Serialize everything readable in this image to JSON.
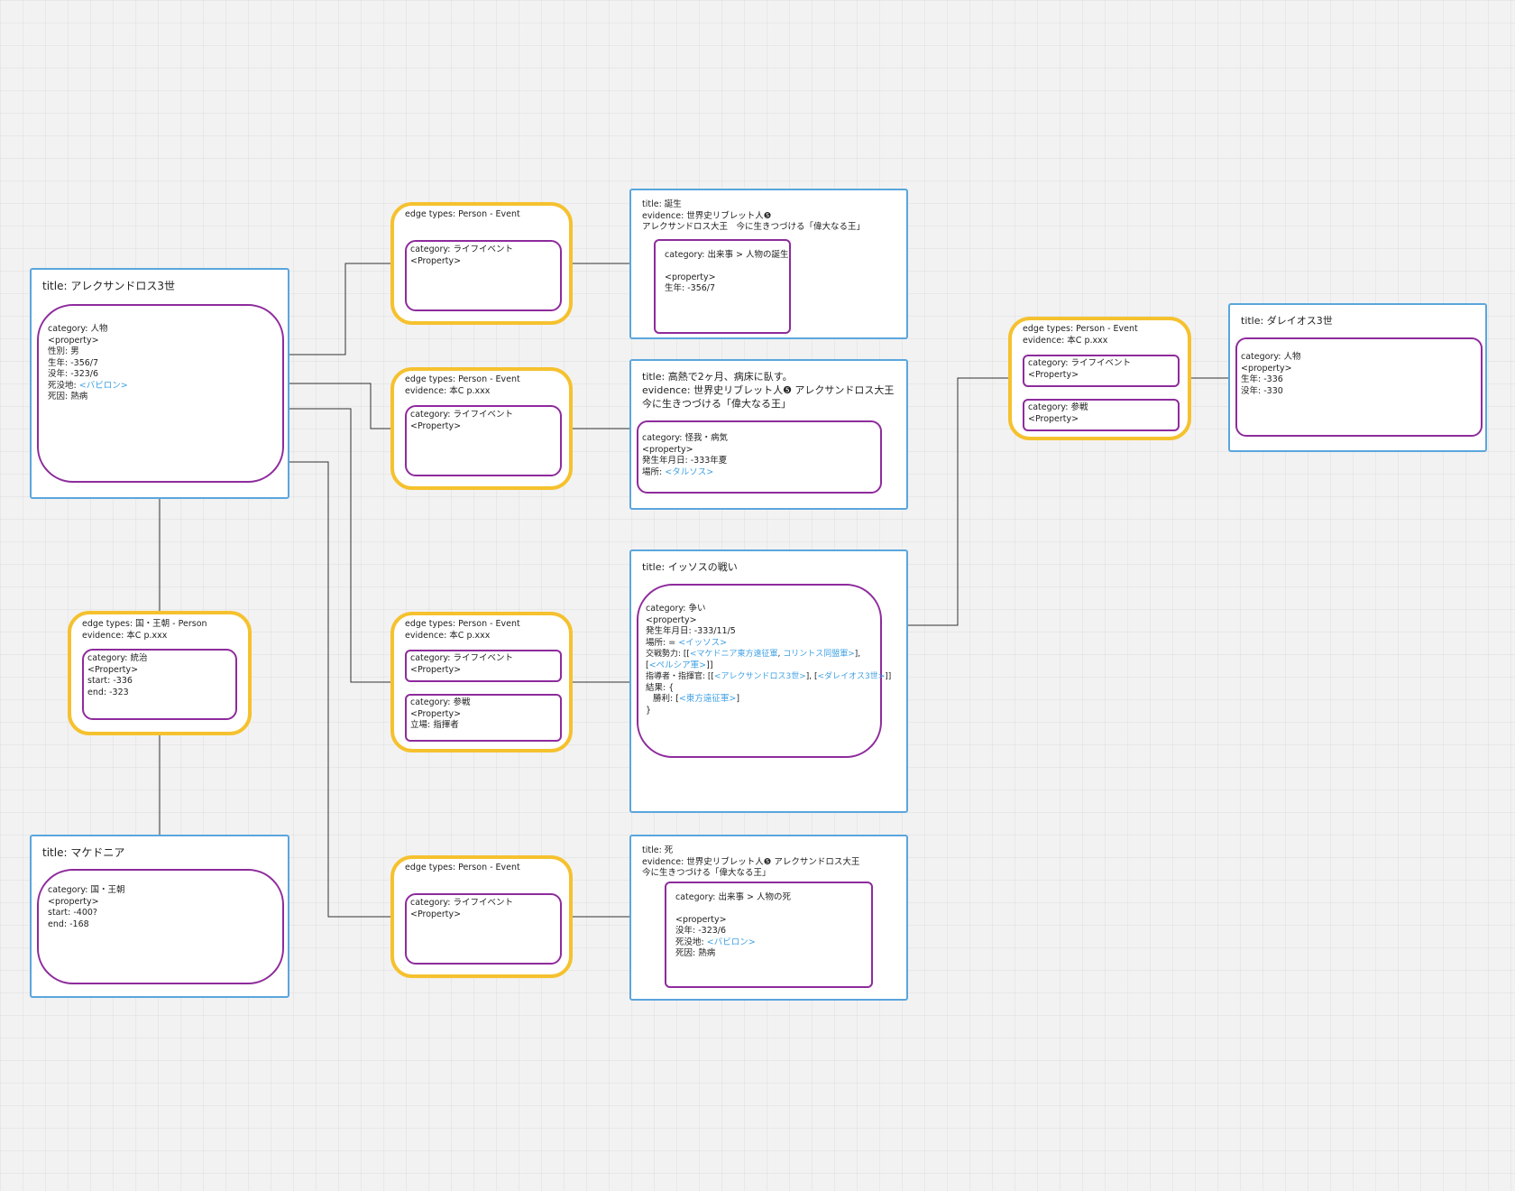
{
  "person_alexander": {
    "title": "title: アレクサンドロス3世",
    "category": "category: 人物",
    "property": "<property>",
    "sex": "性別: 男",
    "birth": "生年: -356/7",
    "death": "没年: -323/6",
    "death_place_label": "死没地: ",
    "death_place_link": "<バビロン>",
    "death_cause": "死因: 熱病"
  },
  "country_macedonia": {
    "title": "title: マケドニア",
    "category": "category: 国・王朝",
    "property": "<property>",
    "start": "start: -400?",
    "end": "end: -168"
  },
  "edge_ruler": {
    "edge_types": "edge types: 国・王朝 - Person",
    "evidence": "evidence: 本C p.xxx",
    "category": "category: 統治",
    "property": "<Property>",
    "start": "start: -336",
    "end": "end: -323"
  },
  "edge_birth": {
    "edge_types": "edge types: Person - Event",
    "category": "category: ライフイベント",
    "property": "<Property>"
  },
  "edge_fever": {
    "edge_types": "edge types: Person - Event",
    "evidence": "evidence: 本C p.xxx",
    "category": "category: ライフイベント",
    "property": "<Property>"
  },
  "edge_battle": {
    "edge_types": "edge types: Person - Event",
    "evidence": "evidence: 本C p.xxx",
    "cat1": "category: ライフイベント",
    "prop1": "<Property>",
    "cat2": "category: 参戦",
    "prop2": "<Property>",
    "role": "立場: 指揮者"
  },
  "edge_death": {
    "edge_types": "edge types: Person - Event",
    "category": "category: ライフイベント",
    "property": "<Property>"
  },
  "edge_darius": {
    "edge_types": "edge types: Person - Event",
    "evidence": "evidence: 本C p.xxx",
    "cat1": "category: ライフイベント",
    "prop1": "<Property>",
    "cat2": "category: 参戦",
    "prop2": "<Property>"
  },
  "event_birth": {
    "title": "title: 誕生",
    "evidence1": "evidence: 世界史リブレット人❺",
    "evidence2": "アレクサンドロス大王　今に生きつづける「偉大なる王」",
    "category": "category: 出来事 > 人物の誕生",
    "property": "<property>",
    "birth": "生年: -356/7"
  },
  "event_fever": {
    "title": "title: 高熱で2ヶ月、病床に臥す。",
    "evidence1": "evidence: 世界史リブレット人❺ アレクサンドロス大王",
    "evidence2": "今に生きつづける「偉大なる王」",
    "category": "category: 怪我・病気",
    "property": "<property>",
    "date": "発生年月日: -333年夏",
    "place_label": "場所: ",
    "place_link": "<タルソス>"
  },
  "event_battle": {
    "title": "title: イッソスの戦い",
    "category": "category: 争い",
    "property": "<property>",
    "date": "発生年月日: -333/11/5",
    "place_label": "場所: = ",
    "place_link": "<イッソス>",
    "forces_label": "交戦勢力: [[",
    "forces_link1": "<マケドニア東方遠征軍",
    "forces_sep": ", ",
    "forces_link2": "コリントス同盟軍>",
    "forces_close1": "],",
    "forces2_open": "[",
    "forces_link3": "<ペルシア軍>",
    "forces2_close": "]]",
    "commanders_label": "指導者・指揮官: [[",
    "commander_link1": "<アレクサンドロス3世>",
    "commanders_mid": "], [",
    "commander_link2": "<ダレイオス3世>",
    "commanders_close": "]]",
    "result_open": "結果: {",
    "victory_label": "勝利: [",
    "victory_link": "<東方遠征軍>",
    "victory_close": "]",
    "result_close": "}"
  },
  "event_death": {
    "title": "title: 死",
    "evidence1": "evidence: 世界史リブレット人❺ アレクサンドロス大王",
    "evidence2": "今に生きつづける「偉大なる王」",
    "category": "category: 出来事 > 人物の死",
    "property": "<property>",
    "death": "没年:  -323/6",
    "place_label": "死没地: ",
    "place_link": "<バビロン>",
    "cause": "死因: 熱病"
  },
  "person_darius": {
    "title": "title: ダレイオス3世",
    "category": "category: 人物",
    "property": "<property>",
    "birth": "生年: -336",
    "death": "没年: -330"
  }
}
